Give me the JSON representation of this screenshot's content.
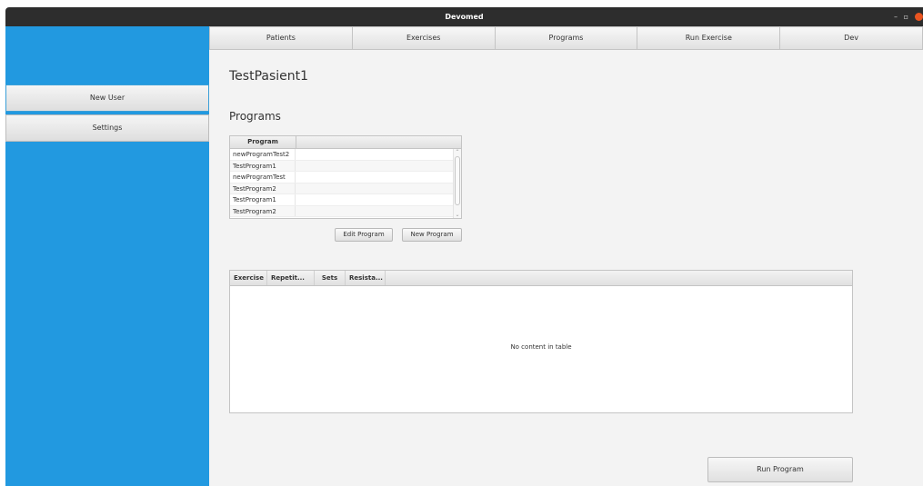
{
  "window": {
    "title": "Devomed",
    "minimize_glyph": "–",
    "maximize_glyph": "▫",
    "close_color": "#e95420"
  },
  "sidebar": {
    "color": "#2299e0",
    "items": [
      {
        "label": "New User"
      },
      {
        "label": "Settings"
      }
    ]
  },
  "nav": {
    "tabs": [
      {
        "label": "Patients"
      },
      {
        "label": "Exercises"
      },
      {
        "label": "Programs"
      },
      {
        "label": "Run Exercise"
      },
      {
        "label": "Dev"
      }
    ]
  },
  "patient": {
    "name": "TestPasient1"
  },
  "programs": {
    "heading": "Programs",
    "column_header": "Program",
    "rows": [
      "newProgramTest2",
      "TestProgram1",
      "newProgramTest",
      "TestProgram2",
      "TestProgram1",
      "TestProgram2"
    ],
    "edit_label": "Edit Program",
    "new_label": "New Program"
  },
  "exercises": {
    "columns": [
      "Exercise",
      "Repetit...",
      "Sets",
      "Resista..."
    ],
    "empty_text": "No content in table"
  },
  "run_label": "Run Program"
}
